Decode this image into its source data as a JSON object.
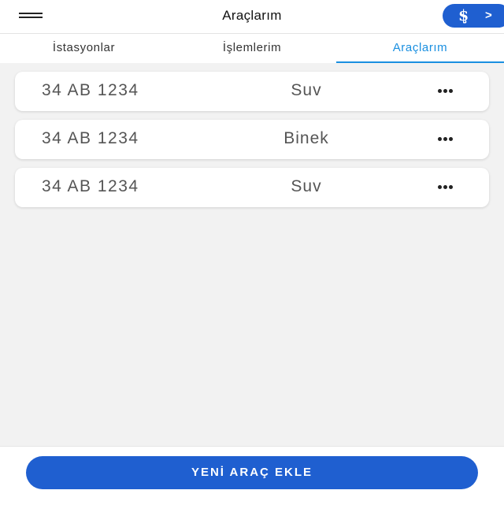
{
  "header": {
    "title": "Araçlarım",
    "menu_icon": "hamburger-menu-icon",
    "brand_logo": "$̧",
    "brand_arrow": ">"
  },
  "tabs": [
    {
      "label": "İstasyonlar",
      "active": false
    },
    {
      "label": "İşlemlerim",
      "active": false
    },
    {
      "label": "Araçlarım",
      "active": true
    }
  ],
  "vehicles": [
    {
      "plate": "34 AB 1234",
      "type": "Suv"
    },
    {
      "plate": "34 AB 1234",
      "type": "Binek"
    },
    {
      "plate": "34 AB 1234",
      "type": "Suv"
    }
  ],
  "footer": {
    "add_button_label": "YENİ ARAÇ EKLE"
  },
  "colors": {
    "accent": "#1a8fe0",
    "brand": "#1f5fd0",
    "background": "#f2f2f2"
  }
}
